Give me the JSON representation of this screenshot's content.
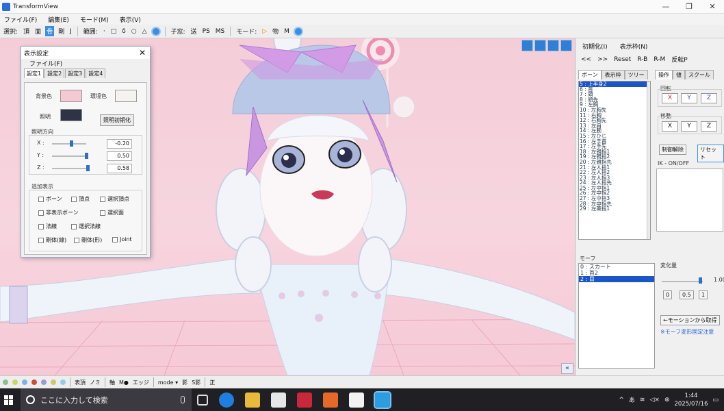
{
  "window": {
    "title": "TransformView",
    "controls": [
      "—",
      "❐",
      "✕"
    ]
  },
  "menu": [
    "ファイル(F)",
    "編集(E)",
    "モード(M)",
    "表示(V)"
  ],
  "toolbar": {
    "select_label": "選択:",
    "select_items": [
      "頂",
      "面",
      "骨",
      "剛",
      "J"
    ],
    "active_select": "骨",
    "range_label": "範囲:",
    "range_items": [
      "·",
      "□",
      "δ",
      "○",
      "△"
    ],
    "child_label": "子窓:",
    "child_items": [
      "送",
      "PS",
      "MS"
    ],
    "mode_label": "モード:",
    "mode_items": [
      "▷",
      "物",
      "M"
    ]
  },
  "dialog": {
    "title": "表示設定",
    "menu": "ファイル(F)",
    "tabs": [
      "設定1",
      "設定2",
      "設定3",
      "設定4"
    ],
    "bg_label": "背景色",
    "env_label": "環境色",
    "light_label": "照明",
    "light_reset": "照明初期化",
    "light_dir_label": "照明方向",
    "axes": [
      {
        "label": "X :",
        "value": "-0.20"
      },
      {
        "label": "Y :",
        "value": "0.50"
      },
      {
        "label": "Z :",
        "value": "0.58"
      }
    ],
    "extra_label": "追加表示",
    "checks": [
      "ボーン",
      "頂点",
      "選択頂点",
      "非表示ボーン",
      "選択面",
      "法線",
      "選択法線",
      "剛体(線)",
      "剛体(形)",
      "Joint"
    ],
    "colors": {
      "bg": "#f6c8d2",
      "env": "#f5f3ef",
      "light": "#2e3346"
    }
  },
  "right": {
    "top_buttons": [
      "初期化(I)",
      "表示枠(N)"
    ],
    "nav": [
      "<<",
      ">>",
      "Reset",
      "R-B",
      "R-M",
      "反転P"
    ],
    "left_tabs": [
      "ボーン",
      "表示枠",
      "ツリー"
    ],
    "right_tabs": [
      "操作",
      "値",
      "スクール"
    ],
    "bones": [
      "5 : 上半身2",
      "6 : 首",
      "7 : 頭",
      "8 : 頭先",
      "9 : 左胸",
      "10 : 左胸先",
      "11 : 右胸",
      "12 : 右胸先",
      "13 : 左肩",
      "14 : 左腕",
      "15 : 左ひじ",
      "16 : 左手首",
      "17 : 左手先",
      "18 : 左親指1",
      "19 : 左親指2",
      "20 : 左親指先",
      "21 : 左人指1",
      "22 : 左人指2",
      "23 : 左人指3",
      "24 : 左人指先",
      "25 : 左中指1",
      "26 : 左中指2",
      "27 : 左中指3",
      "28 : 左中指先",
      "29 : 左薬指1"
    ],
    "rotate_label": "回転",
    "move_label": "移動",
    "axis_buttons": [
      "X",
      "Y",
      "Z"
    ],
    "lock_btn": "制御解除",
    "reset_btn": "リセット",
    "ik_label": "IK - ON/OFF",
    "morph_label": "モーフ",
    "morphs": [
      "0 : スカート",
      "1 : 首2",
      "2 : 目"
    ],
    "change_label": "変化量",
    "change_value": "1.00",
    "presets": [
      "0",
      "0.5",
      "1"
    ],
    "from_motion": "←モーションから取得",
    "note": "※モーフ変形固定注意"
  },
  "bottombar": [
    "表頂",
    "ノミ",
    "軸",
    "M●",
    "エッジ",
    "mode ▾",
    "影",
    "S影",
    "正"
  ],
  "taskbar": {
    "search_placeholder": "ここに入力して検索",
    "time": "1:44",
    "date": "2025/07/16"
  }
}
